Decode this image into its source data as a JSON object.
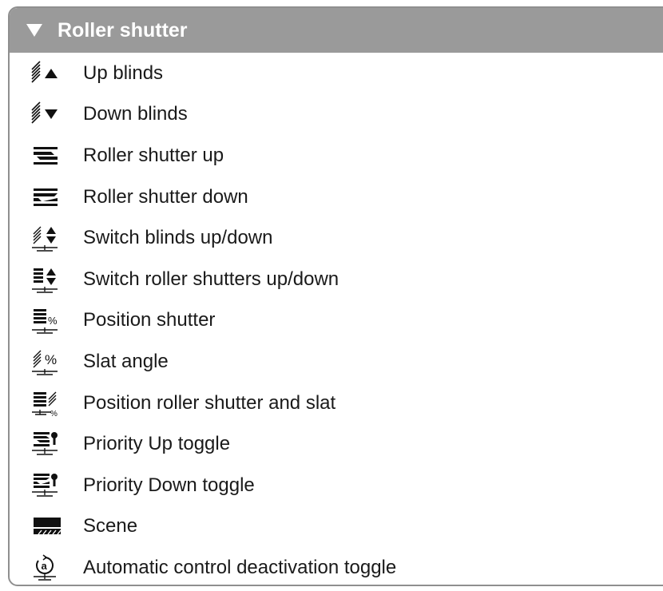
{
  "header": {
    "title": "Roller shutter",
    "collapse_icon": "triangle-down-icon"
  },
  "items": [
    {
      "label": "Up blinds",
      "icon": "blinds-up-icon"
    },
    {
      "label": "Down blinds",
      "icon": "blinds-down-icon"
    },
    {
      "label": "Roller shutter up",
      "icon": "roller-shutter-up-icon"
    },
    {
      "label": "Roller shutter down",
      "icon": "roller-shutter-down-icon"
    },
    {
      "label": "Switch blinds up/down",
      "icon": "switch-blinds-icon"
    },
    {
      "label": "Switch roller shutters up/down",
      "icon": "switch-roller-shutters-icon"
    },
    {
      "label": "Position shutter",
      "icon": "position-shutter-icon"
    },
    {
      "label": "Slat angle",
      "icon": "slat-angle-icon"
    },
    {
      "label": "Position roller shutter and slat",
      "icon": "position-shutter-slat-icon"
    },
    {
      "label": "Priority Up toggle",
      "icon": "priority-up-icon"
    },
    {
      "label": "Priority Down toggle",
      "icon": "priority-down-icon"
    },
    {
      "label": "Scene",
      "icon": "scene-icon"
    },
    {
      "label": "Automatic control deactivation toggle",
      "icon": "automatic-control-icon"
    }
  ]
}
